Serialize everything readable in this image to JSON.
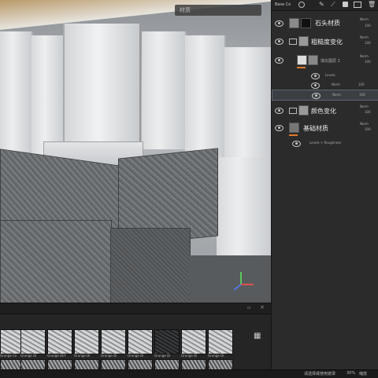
{
  "viewport": {
    "search_placeholder": "材质"
  },
  "layers_panel": {
    "blend_mode": "Base Co",
    "layers": [
      {
        "name": "石头材质",
        "mode": "Norm"
      },
      {
        "name": "粗糙度变化",
        "mode": "Norm"
      },
      {
        "name": "填充图层 2",
        "mode": "Norm"
      },
      {
        "name": "Levels",
        "mode": ""
      },
      {
        "name": "Norm",
        "mode": "100"
      },
      {
        "name": "Norm",
        "mode": "100"
      },
      {
        "name": "颜色变化",
        "mode": "Norm"
      },
      {
        "name": "基础材质",
        "mode": "Norm"
      },
      {
        "name": "Levels > Roughness",
        "mode": ""
      }
    ],
    "opacity": "100"
  },
  "library": {
    "tiles": [
      "Grunge Co",
      "Grunge Dr",
      "Grunge Dirt",
      "Grunge Dr",
      "Grunge Di",
      "Grunge Dr",
      "Grunge Dr",
      "Grunge Di",
      "Grunge Dr"
    ]
  },
  "status": {
    "hint": "请选择或使用遮罩",
    "zoom": "30%",
    "extra": "缩放"
  },
  "colors": {
    "accent": "#e07a2c",
    "panel_bg": "#2b2b2b"
  }
}
